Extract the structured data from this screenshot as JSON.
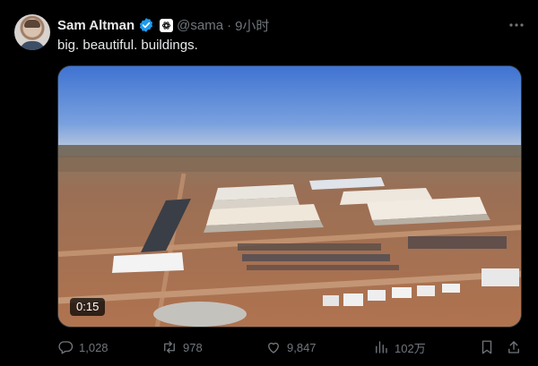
{
  "tweet": {
    "author": {
      "name": "Sam Altman",
      "handle": "@sama",
      "separator": "·",
      "time": "9小时"
    },
    "text": "big. beautiful. buildings.",
    "media": {
      "type": "video",
      "duration": "0:15"
    },
    "metrics": {
      "replies": "1,028",
      "reposts": "978",
      "likes": "9,847",
      "views": "102万"
    },
    "icons": {
      "verified": "verified-badge-icon",
      "affiliation": "openai-logo-icon",
      "more": "more-options-icon",
      "reply": "reply-icon",
      "repost": "repost-icon",
      "like": "like-icon",
      "views": "views-icon",
      "bookmark": "bookmark-icon",
      "share": "share-icon"
    },
    "colors": {
      "background": "#000000",
      "text": "#e7e9ea",
      "muted": "#71767b",
      "verified": "#1d9bf0"
    }
  }
}
